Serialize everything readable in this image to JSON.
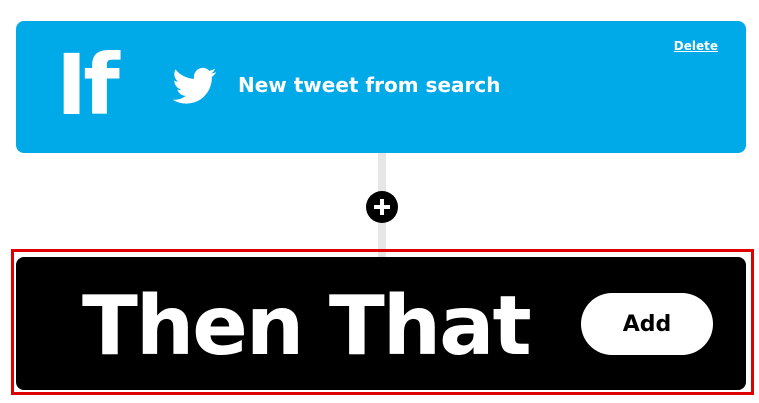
{
  "trigger": {
    "keyword": "If",
    "service_icon": "twitter-bird-icon",
    "title": "New tweet from search",
    "delete_label": "Delete",
    "color": "#00a9e8"
  },
  "connector": {
    "add_icon": "plus-circle-icon"
  },
  "action": {
    "title": "Then That",
    "add_label": "Add",
    "color": "#000000"
  },
  "highlight_color": "#e00000"
}
